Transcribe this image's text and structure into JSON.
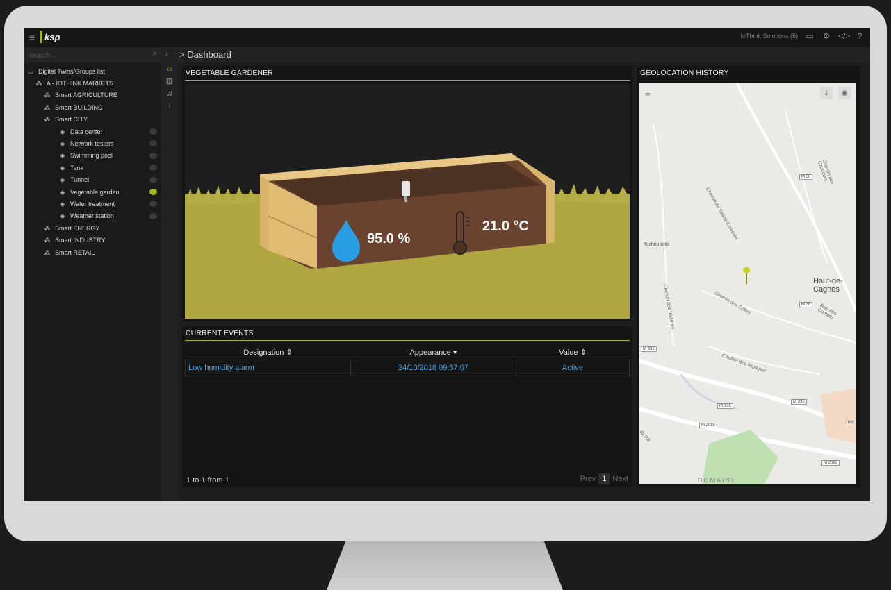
{
  "app": {
    "account_label": "IoThink Solutions (5)",
    "logo_text": "ksp"
  },
  "search": {
    "placeholder": "search ..."
  },
  "breadcrumb": {
    "path": "> Dashboard"
  },
  "tree": {
    "root": "Digital Twins/Groups list",
    "items": [
      {
        "label": "A - IOTHINK MARKETS",
        "level": 1,
        "icon": "group-icon"
      },
      {
        "label": "Smart AGRICULTURE",
        "level": 2,
        "icon": "group-icon"
      },
      {
        "label": "Smart BUILDING",
        "level": 2,
        "icon": "group-icon"
      },
      {
        "label": "Smart CITY",
        "level": 2,
        "icon": "group-icon"
      },
      {
        "label": "Data center",
        "level": 3,
        "icon": "device-icon",
        "eye": true
      },
      {
        "label": "Network testers",
        "level": 3,
        "icon": "device-icon",
        "eye": true
      },
      {
        "label": "Swimming pool",
        "level": 3,
        "icon": "device-icon",
        "eye": true
      },
      {
        "label": "Tank",
        "level": 3,
        "icon": "device-icon",
        "eye": true
      },
      {
        "label": "Tunnel",
        "level": 3,
        "icon": "device-icon",
        "eye": true
      },
      {
        "label": "Vegetable garden",
        "level": 3,
        "icon": "device-icon",
        "eye": true,
        "active": true
      },
      {
        "label": "Water treatment",
        "level": 3,
        "icon": "device-icon",
        "eye": true
      },
      {
        "label": "Weather station",
        "level": 3,
        "icon": "device-icon",
        "eye": true
      },
      {
        "label": "Smart ENERGY",
        "level": 2,
        "icon": "group-icon"
      },
      {
        "label": "Smart INDUSTRY",
        "level": 2,
        "icon": "group-icon"
      },
      {
        "label": "Smart RETAIL",
        "level": 2,
        "icon": "group-icon"
      }
    ]
  },
  "garden_panel": {
    "title": "VEGETABLE GARDENER",
    "humidity": "95.0 %",
    "temperature": "21.0 °C"
  },
  "events_panel": {
    "title": "CURRENT EVENTS",
    "columns": [
      "Designation ⇕",
      "Appearance ▾",
      "Value ⇕"
    ],
    "rows": [
      [
        "Low humidity alarm",
        "24/10/2018 09:57:07",
        "Active"
      ]
    ],
    "footer": "1 to 1 from 1",
    "pager": {
      "prev": "Prev",
      "page": "1",
      "next": "Next"
    }
  },
  "geo_panel": {
    "title": "GEOLOCATION HISTORY",
    "places": [
      "Technopolis",
      "Haut-de-Cagnes",
      "Chemin de Sainte-Colombe",
      "Chemin des Caucours",
      "Chemin des Colles",
      "Rue des Combes",
      "Chemin des Vallières",
      "Chemin des Roseaux",
      "DOMAINE",
      "du Pilt",
      "Jule"
    ],
    "roads": [
      "M 36",
      "M 36",
      "M 336",
      "M 336",
      "M 336",
      "M 2085",
      "M 2085"
    ]
  },
  "colors": {
    "accent": "#a4b81e",
    "link": "#4aa3df"
  }
}
